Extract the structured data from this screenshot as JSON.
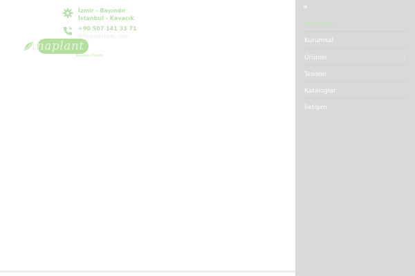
{
  "contact": {
    "locations": [
      "İzmir - Bayındır",
      "İstanbul - Kavacık"
    ],
    "phone": "+90 507 141 33 71",
    "email": "info@abcplan.com"
  },
  "logo": {
    "word": "Anaplant",
    "tagline": "Tasarım Üretim"
  },
  "menu": {
    "toggle_icon": "≡",
    "items": [
      {
        "label": "Anasayfa",
        "active": true
      },
      {
        "label": "Kurumsal"
      },
      {
        "label": "Ürünler",
        "has_submenu": true,
        "submenu_icon": "›"
      },
      {
        "label": "Tesisler"
      },
      {
        "label": "Kataloglar"
      },
      {
        "label": "İletişim"
      }
    ]
  },
  "colors": {
    "accent_green": "#b5df9f",
    "menu_background": "#d9d9d9",
    "menu_text": "#ffffff"
  }
}
